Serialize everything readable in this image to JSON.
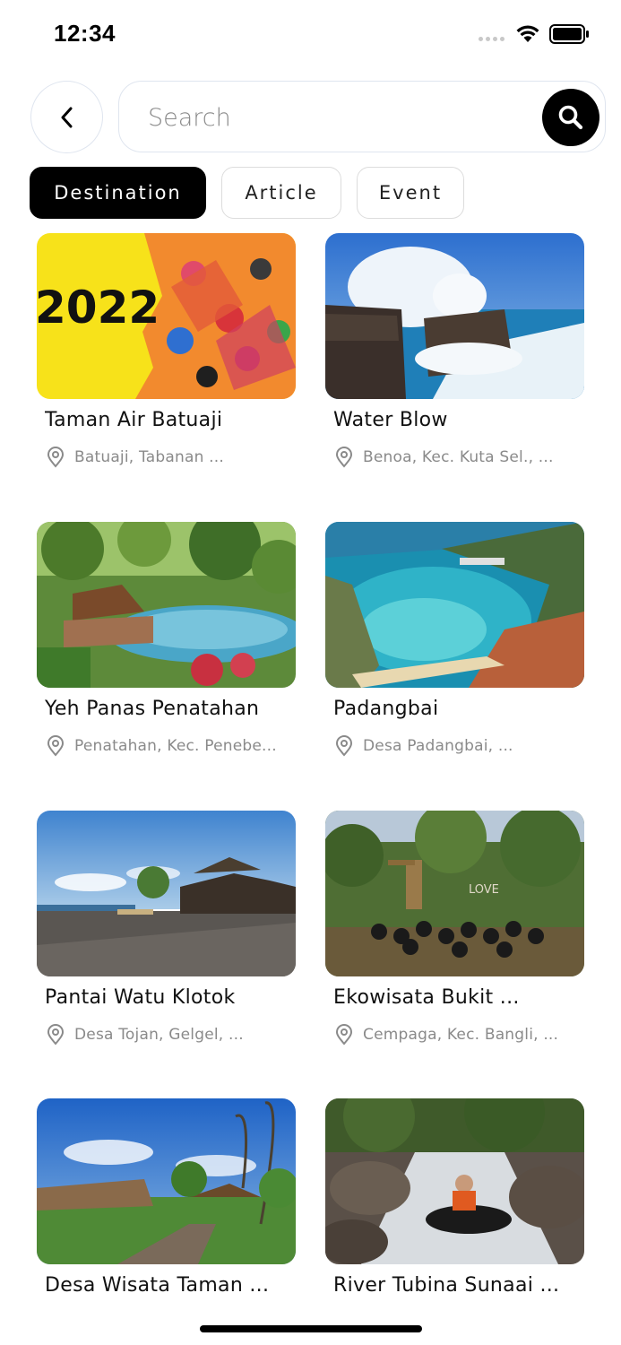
{
  "status": {
    "time": "12:34"
  },
  "search": {
    "placeholder": "Search",
    "value": ""
  },
  "icons": {
    "back": "chevron-left-icon",
    "search": "magnifier-icon",
    "location": "map-pin-icon"
  },
  "tabs": [
    {
      "label": "Destination",
      "active": true
    },
    {
      "label": "Article",
      "active": false
    },
    {
      "label": "Event",
      "active": false
    }
  ],
  "cards": [
    {
      "title": "Taman Air Batuaji",
      "location": "Batuaji, Tabanan ...",
      "image": "2022 sports event poster"
    },
    {
      "title": "Water Blow",
      "location": "Benoa, Kec. Kuta Sel., ...",
      "image": "waves crashing on rocks"
    },
    {
      "title": "Yeh Panas Penatahan",
      "location": "Penatahan, Kec. Penebe...",
      "image": "hot spring pool in jungle"
    },
    {
      "title": "Padangbai",
      "location": "Desa Padangbai, ...",
      "image": "aerial view of bay with boats"
    },
    {
      "title": "Pantai Watu Klotok",
      "location": "Desa Tojan, Gelgel, ...",
      "image": "black sand beach with temple"
    },
    {
      "title": "Ekowisata Bukit ...",
      "location": "Cempaga, Kec. Bangli, ...",
      "image": "group gathering in forest"
    },
    {
      "title": "Desa Wisata Taman ...",
      "location": "",
      "image": "village with penjor decorations"
    },
    {
      "title": "River Tubina Sunaai ...",
      "location": "",
      "image": "river tubing on rocky stream"
    }
  ],
  "colors": {
    "accent": "#000000",
    "border": "#dfe5ef",
    "muted_text": "#8a8a8a"
  },
  "page": "Destination search results"
}
